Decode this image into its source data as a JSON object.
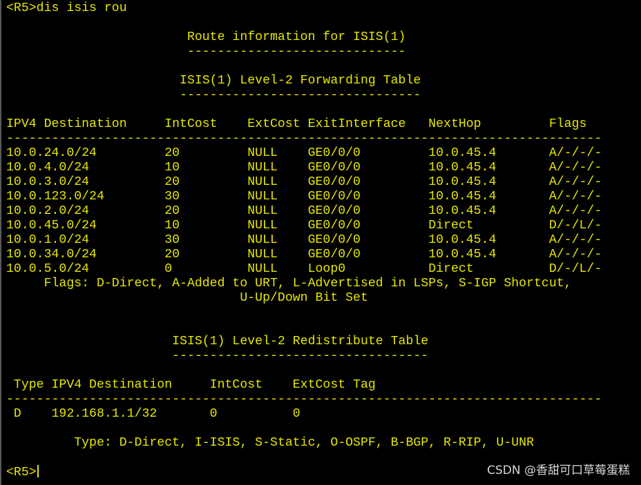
{
  "terminal": {
    "prompt_command": "<R5>dis isis rou",
    "title": "                        Route information for ISIS(1)",
    "title_rule": "                        -----------------------------",
    "forwarding_title": "                       ISIS(1) Level-2 Forwarding Table",
    "forwarding_rule": "                       --------------------------------",
    "forwarding_header": "IPV4 Destination     IntCost    ExtCost ExitInterface   NextHop         Flags",
    "forwarding_separator": "-------------------------------------------------------------------------------",
    "forwarding_rows": [
      "10.0.24.0/24         20         NULL    GE0/0/0         10.0.45.4       A/-/-/-",
      "10.0.4.0/24          10         NULL    GE0/0/0         10.0.45.4       A/-/-/-",
      "10.0.3.0/24          20         NULL    GE0/0/0         10.0.45.4       A/-/-/-",
      "10.0.123.0/24        30         NULL    GE0/0/0         10.0.45.4       A/-/-/-",
      "10.0.2.0/24          20         NULL    GE0/0/0         10.0.45.4       A/-/-/-",
      "10.0.45.0/24         10         NULL    GE0/0/0         Direct          D/-/L/-",
      "10.0.1.0/24          30         NULL    GE0/0/0         10.0.45.4       A/-/-/-",
      "10.0.34.0/24         20         NULL    GE0/0/0         10.0.45.4       A/-/-/-",
      "10.0.5.0/24          0          NULL    Loop0           Direct          D/-/L/-"
    ],
    "flags_legend_1": "     Flags: D-Direct, A-Added to URT, L-Advertised in LSPs, S-IGP Shortcut,",
    "flags_legend_2": "                               U-Up/Down Bit Set",
    "redistribute_title": "                      ISIS(1) Level-2 Redistribute Table",
    "redistribute_rule": "                      ----------------------------------",
    "redistribute_header": " Type IPV4 Destination     IntCost    ExtCost Tag",
    "redistribute_separator": "-------------------------------------------------------------------------------",
    "redistribute_rows": [
      " D    192.168.1.1/32       0          0"
    ],
    "type_legend": "         Type: D-Direct, I-ISIS, S-Static, O-OSPF, B-BGP, R-RIP, U-UNR",
    "final_prompt": "<R5>"
  },
  "watermark": "CSDN @香甜可口草莓蛋糕",
  "colors": {
    "background": "#000000",
    "text": "#e6e600",
    "watermark": "#d8d8d8"
  }
}
